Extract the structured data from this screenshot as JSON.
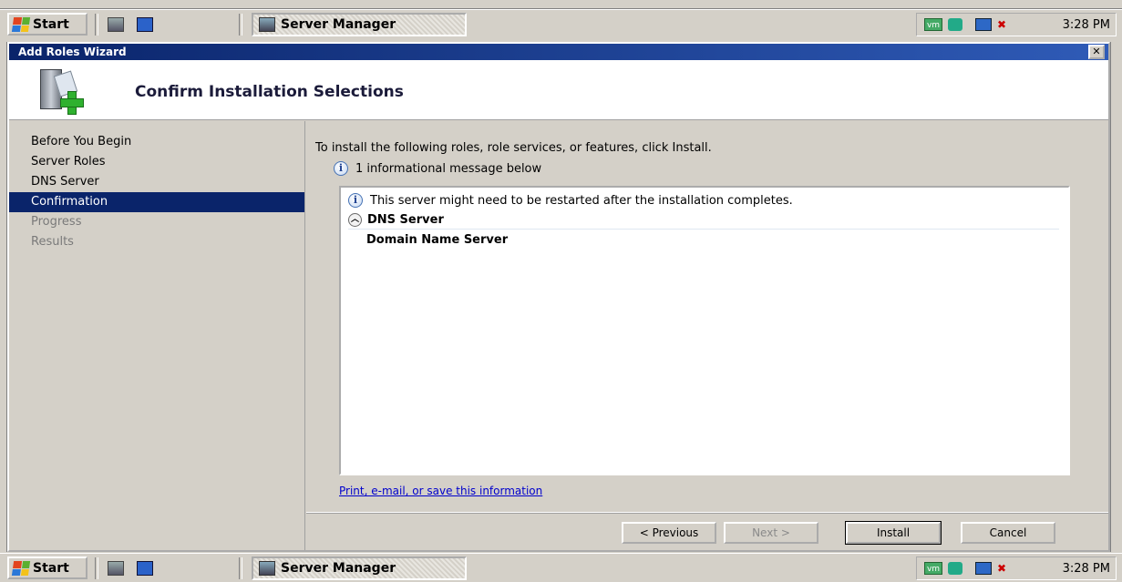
{
  "taskbar": {
    "start_label": "Start",
    "task_label": "Server Manager",
    "clock": "3:28 PM",
    "tray_vm_label": "vm"
  },
  "wizard": {
    "window_title": "Add Roles Wizard",
    "close_glyph": "✕",
    "header_title": "Confirm Installation Selections",
    "nav": [
      {
        "label": "Before You Begin",
        "state": "done"
      },
      {
        "label": "Server Roles",
        "state": "done"
      },
      {
        "label": "DNS Server",
        "state": "done"
      },
      {
        "label": "Confirmation",
        "state": "active"
      },
      {
        "label": "Progress",
        "state": "disabled"
      },
      {
        "label": "Results",
        "state": "disabled"
      }
    ],
    "intro_text": "To install the following roles, role services, or features, click Install.",
    "info_summary": "1 informational message below",
    "listbox": {
      "message": "This server might need to be restarted after the installation completes.",
      "group_title": "DNS Server",
      "item": "Domain Name Server"
    },
    "link_text": "Print, e-mail, or save this information",
    "buttons": {
      "previous": "< Previous",
      "next": "Next >",
      "install": "Install",
      "cancel": "Cancel"
    }
  }
}
